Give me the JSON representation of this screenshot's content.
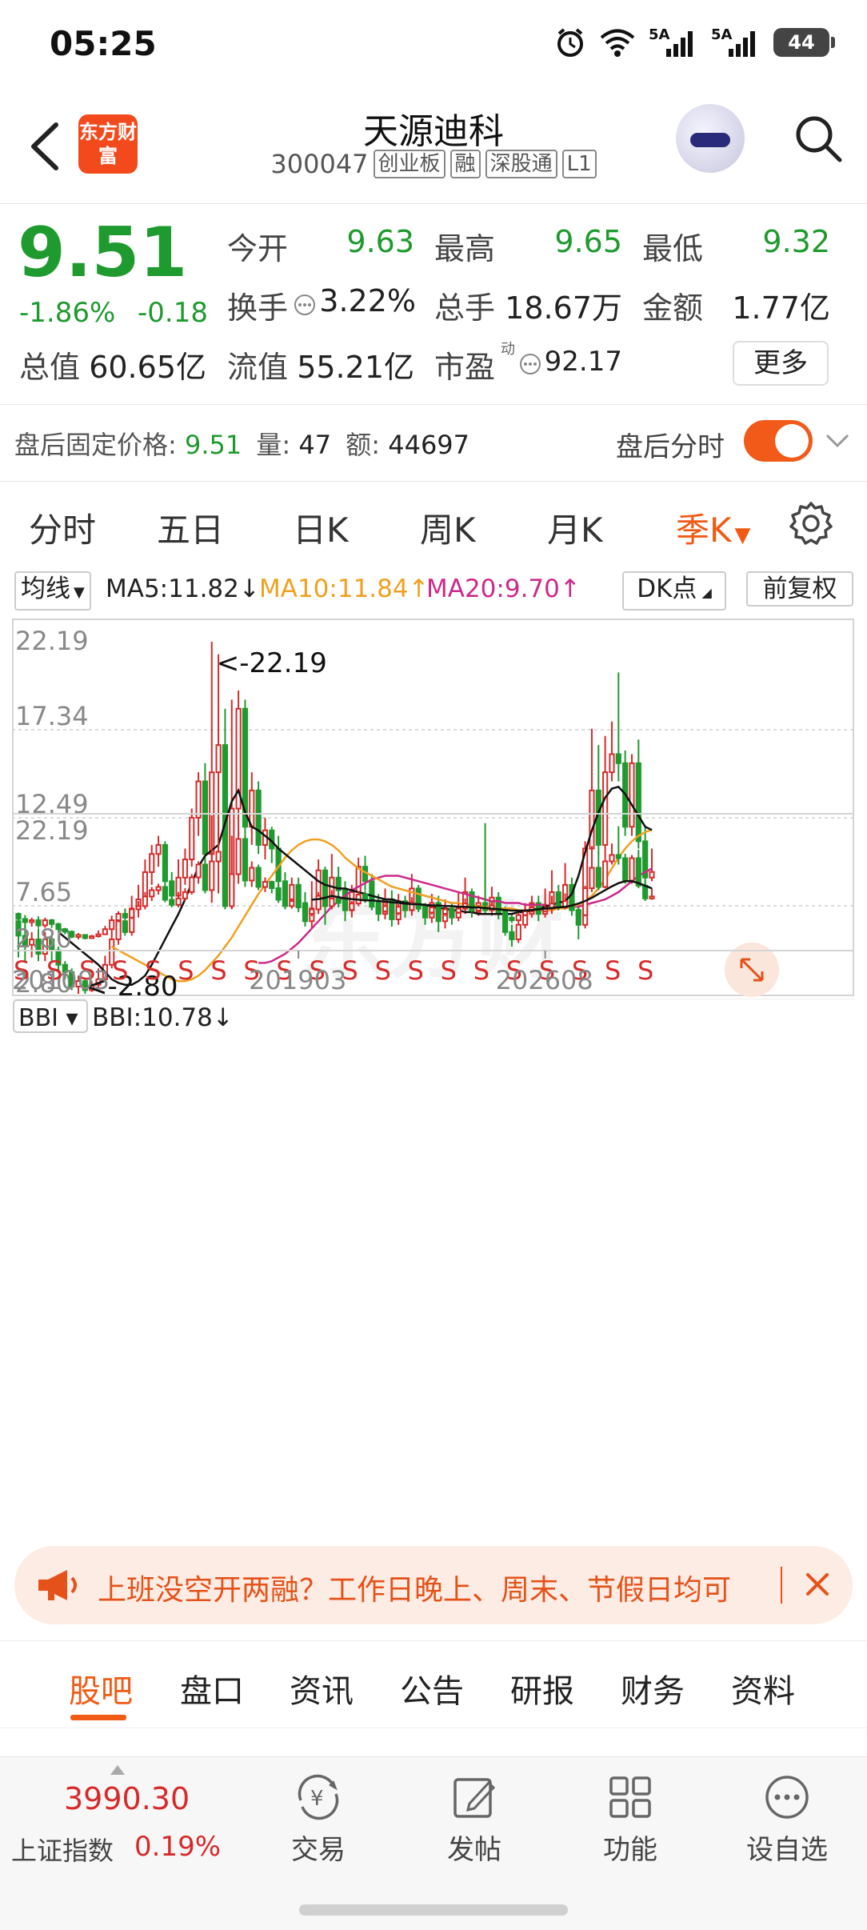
{
  "status": {
    "time": "05:25",
    "sig1": "5A",
    "sig2": "5A",
    "battery": "44"
  },
  "header": {
    "logo": "东方财富",
    "name": "天源迪科",
    "code": "300047",
    "tags": [
      "创业板",
      "融",
      "深股通",
      "L1"
    ]
  },
  "quote": {
    "price": "9.51",
    "change_pct": "-1.86%",
    "change": "-0.18",
    "labels": {
      "open": "今开",
      "high": "最高",
      "low": "最低",
      "turnover": "换手",
      "volume": "总手",
      "amount": "金额",
      "mcap": "总值",
      "float": "流值",
      "pe": "市盈"
    },
    "open": "9.63",
    "high": "9.65",
    "low": "9.32",
    "turnover": "3.22%",
    "volume": "18.67万",
    "amount": "1.77亿",
    "mcap": "60.65亿",
    "float": "55.21亿",
    "pe_sup": "动",
    "pe": "92.17",
    "more": "更多"
  },
  "after_hours": {
    "price_label": "盘后固定价格:",
    "price": "9.51",
    "vol_label": "量:",
    "vol": "47",
    "amt_label": "额:",
    "amt": "44697",
    "toggle_label": "盘后分时",
    "toggle_on": true
  },
  "tabs": [
    "分时",
    "五日",
    "日K",
    "周K",
    "月K",
    "季K"
  ],
  "active_tab": "季K",
  "indicators": {
    "ma_select": "均线",
    "ma5": "MA5:11.82↓",
    "ma10": "MA10:11.84↑",
    "ma20": "MA20:9.70↑",
    "dk": "DK点",
    "adjust": "前复权",
    "bbi_select": "BBI",
    "bbi": "BBI:10.78↓"
  },
  "colors": {
    "up": "#d62a2a",
    "down": "#1f9a2f",
    "ma5": "#111111",
    "ma10": "#f0a020",
    "ma20": "#cc2a8a",
    "accent": "#f05a14"
  },
  "chart_data": {
    "type": "candlestick",
    "title": "",
    "main_y_ticks": [
      "22.19",
      "17.34",
      "12.49",
      "7.65",
      "2.80"
    ],
    "sub_y_ticks": [
      "22.19",
      "2.80"
    ],
    "x_ticks": [
      "201003",
      "201903",
      "202608"
    ],
    "ylim": [
      2.8,
      22.19
    ],
    "max_label": "<-22.19",
    "min_label": "<-2.80",
    "signals": [
      "S",
      "S",
      "S",
      "S",
      "S",
      "S",
      "S",
      "S",
      "S",
      "S",
      "S",
      "S",
      "S",
      "S",
      "S",
      "S",
      "S",
      "S",
      "S",
      "S"
    ],
    "candles": [
      [
        6.8,
        6.0,
        7.0,
        4.8
      ],
      [
        6.0,
        5.5,
        6.6,
        4.5
      ],
      [
        5.5,
        5.8,
        6.2,
        4.8
      ],
      [
        5.8,
        5.0,
        6.4,
        4.6
      ],
      [
        5.0,
        5.8,
        6.2,
        4.6
      ],
      [
        5.8,
        5.2,
        6.0,
        4.6
      ],
      [
        5.2,
        4.4,
        5.4,
        4.0
      ],
      [
        4.4,
        4.0,
        4.6,
        3.6
      ],
      [
        4.0,
        3.2,
        4.2,
        3.0
      ],
      [
        3.2,
        3.5,
        3.8,
        2.8
      ],
      [
        3.5,
        3.0,
        3.6,
        2.8
      ],
      [
        3.0,
        3.3,
        3.5,
        2.9
      ],
      [
        3.3,
        3.6,
        4.2,
        3.1
      ],
      [
        3.6,
        4.4,
        4.9,
        3.5
      ],
      [
        4.4,
        5.8,
        6.5,
        4.2
      ],
      [
        5.8,
        6.8,
        7.2,
        5.5
      ],
      [
        6.8,
        6.2,
        7.5,
        6.0
      ],
      [
        6.2,
        7.5,
        8.2,
        6.0
      ],
      [
        7.5,
        8.0,
        8.8,
        7.0
      ],
      [
        8.0,
        9.5,
        10.2,
        7.5
      ],
      [
        9.5,
        10.5,
        11.0,
        8.8
      ],
      [
        10.5,
        11.0,
        11.5,
        9.8
      ],
      [
        11.0,
        9.0,
        11.2,
        8.6
      ],
      [
        9.0,
        8.2,
        9.5,
        7.8
      ],
      [
        8.2,
        9.2,
        10.2,
        7.8
      ],
      [
        9.2,
        10.2,
        10.8,
        8.8
      ],
      [
        10.2,
        12.5,
        13.0,
        9.8
      ],
      [
        12.5,
        14.5,
        15.0,
        11.5
      ],
      [
        14.5,
        10.5,
        15.5,
        10.0
      ],
      [
        10.5,
        15.0,
        22.19,
        8.5
      ],
      [
        15.0,
        16.5,
        21.5,
        10.0
      ],
      [
        16.5,
        8.0,
        18.5,
        7.5
      ],
      [
        8.0,
        13.0,
        19.0,
        7.5
      ],
      [
        13.0,
        18.5,
        19.5,
        11.5
      ],
      [
        18.5,
        12.0,
        19.0,
        11.0
      ],
      [
        12.0,
        14.0,
        15.0,
        11.0
      ],
      [
        14.0,
        11.0,
        14.5,
        10.5
      ],
      [
        11.0,
        11.8,
        12.5,
        10.2
      ],
      [
        11.8,
        10.8,
        12.0,
        10.0
      ],
      [
        10.8,
        9.0,
        11.5,
        8.5
      ],
      [
        9.0,
        8.0,
        9.5,
        7.5
      ],
      [
        8.0,
        8.8,
        9.2,
        7.6
      ],
      [
        8.8,
        7.8,
        9.2,
        7.3
      ],
      [
        7.8,
        6.8,
        8.4,
        6.5
      ],
      [
        6.8,
        7.5,
        9.0,
        6.4
      ],
      [
        7.5,
        9.6,
        10.2,
        7.2
      ],
      [
        9.6,
        8.0,
        9.8,
        6.6
      ],
      [
        8.0,
        9.2,
        10.5,
        7.5
      ],
      [
        9.2,
        8.5,
        9.8,
        7.8
      ],
      [
        8.5,
        7.4,
        9.0,
        6.8
      ],
      [
        7.4,
        8.4,
        8.8,
        7.0
      ],
      [
        8.4,
        9.8,
        10.3,
        8.0
      ],
      [
        9.8,
        9.0,
        10.4,
        8.5
      ],
      [
        9.0,
        7.9,
        9.4,
        7.4
      ],
      [
        7.9,
        7.2,
        8.3,
        6.8
      ],
      [
        7.2,
        8.0,
        8.6,
        6.9
      ],
      [
        8.0,
        6.9,
        8.5,
        6.5
      ],
      [
        6.9,
        7.9,
        8.3,
        6.6
      ],
      [
        7.9,
        7.4,
        8.2,
        7.0
      ],
      [
        7.4,
        8.6,
        9.4,
        7.1
      ],
      [
        8.6,
        7.6,
        8.8,
        7.3
      ],
      [
        7.6,
        7.0,
        7.8,
        6.6
      ],
      [
        7.0,
        7.8,
        8.3,
        6.7
      ],
      [
        7.8,
        6.8,
        8.2,
        6.2
      ],
      [
        6.8,
        7.5,
        8.0,
        6.4
      ],
      [
        7.5,
        7.0,
        7.8,
        6.6
      ],
      [
        7.0,
        7.6,
        8.4,
        6.8
      ],
      [
        7.6,
        8.4,
        9.2,
        7.2
      ],
      [
        8.4,
        7.3,
        8.6,
        7.0
      ],
      [
        7.3,
        7.8,
        8.2,
        7.1
      ],
      [
        7.8,
        7.4,
        12.2,
        7.2
      ],
      [
        7.4,
        8.1,
        8.7,
        7.1
      ],
      [
        8.1,
        7.2,
        8.4,
        6.9
      ],
      [
        7.2,
        6.2,
        7.6,
        6.0
      ],
      [
        6.2,
        5.8,
        6.6,
        5.4
      ],
      [
        5.8,
        6.6,
        7.0,
        5.6
      ],
      [
        6.6,
        7.2,
        7.8,
        6.4
      ],
      [
        7.2,
        7.8,
        8.2,
        7.0
      ],
      [
        7.8,
        7.2,
        8.2,
        6.8
      ],
      [
        7.2,
        7.6,
        8.6,
        7.0
      ],
      [
        7.6,
        8.4,
        9.6,
        7.2
      ],
      [
        8.4,
        7.8,
        8.8,
        7.4
      ],
      [
        7.8,
        8.8,
        10.0,
        7.5
      ],
      [
        8.8,
        7.4,
        9.2,
        7.1
      ],
      [
        7.4,
        6.6,
        7.8,
        5.8
      ],
      [
        6.6,
        10.8,
        11.2,
        6.4
      ],
      [
        10.8,
        14.0,
        17.4,
        10.2
      ],
      [
        14.0,
        11.0,
        16.5,
        10.5
      ],
      [
        11.0,
        15.0,
        17.0,
        10.8
      ],
      [
        15.0,
        16.0,
        17.8,
        14.5
      ],
      [
        16.0,
        15.5,
        20.5,
        14.5
      ],
      [
        15.5,
        12.0,
        16.2,
        11.5
      ],
      [
        12.0,
        15.5,
        16.0,
        11.5
      ],
      [
        15.5,
        11.2,
        16.8,
        10.8
      ],
      [
        11.2,
        9.2,
        12.0,
        8.8
      ],
      [
        9.2,
        9.51,
        10.8,
        9.0
      ]
    ],
    "ma5": [
      6.2,
      5.9,
      5.6,
      5.3,
      5.0,
      4.7,
      4.4,
      4.0,
      3.6,
      3.4,
      3.3,
      3.3,
      3.5,
      3.8,
      4.4,
      5.1,
      5.8,
      6.5,
      7.2,
      8.0,
      8.9,
      9.8,
      10.4,
      10.7,
      11.0,
      12.2,
      13.4,
      14.0,
      12.8,
      12.0,
      11.8,
      11.5,
      11.2,
      10.8,
      10.5,
      10.2,
      9.9,
      9.6,
      9.3,
      9.0,
      8.8,
      8.7,
      8.6,
      8.6,
      8.5,
      8.4,
      8.3,
      8.2,
      8.1,
      8.0,
      8.0,
      7.9,
      7.8,
      7.8,
      7.7,
      7.7,
      7.6,
      7.5,
      7.5,
      7.4,
      7.4,
      7.3,
      7.3,
      7.2,
      7.2,
      7.2,
      7.2,
      7.2,
      7.2,
      7.3,
      7.3,
      7.4,
      7.5,
      7.6,
      7.7,
      7.8,
      7.9,
      8.3,
      9.3,
      10.6,
      11.8,
      12.8,
      13.6,
      14.1,
      14.2,
      13.8,
      13.2,
      12.6,
      12.0,
      11.82
    ],
    "ma10": [
      5.4,
      5.2,
      5.0,
      4.8,
      4.6,
      4.4,
      4.2,
      4.0,
      3.8,
      3.6,
      3.5,
      3.5,
      3.6,
      3.8,
      4.1,
      4.5,
      4.9,
      5.4,
      5.9,
      6.5,
      7.1,
      7.7,
      8.3,
      8.8,
      9.3,
      9.8,
      10.3,
      10.7,
      11.0,
      11.2,
      11.3,
      11.3,
      11.2,
      11.0,
      10.7,
      10.3,
      10.0,
      9.7,
      9.5,
      9.3,
      9.1,
      8.9,
      8.7,
      8.6,
      8.5,
      8.4,
      8.3,
      8.2,
      8.1,
      8.0,
      7.9,
      7.8,
      7.8,
      7.7,
      7.7,
      7.6,
      7.6,
      7.6,
      7.5,
      7.5,
      7.5,
      7.4,
      7.4,
      7.4,
      7.4,
      7.4,
      7.4,
      7.5,
      7.5,
      7.6,
      7.7,
      7.9,
      8.2,
      8.6,
      9.1,
      9.7,
      10.3,
      10.8,
      11.2,
      11.5,
      11.7,
      11.84
    ],
    "ma20": [
      4.5,
      4.5,
      4.6,
      4.8,
      5.0,
      5.3,
      5.6,
      6.0,
      6.4,
      6.8,
      7.2,
      7.6,
      7.9,
      8.2,
      8.5,
      8.7,
      8.9,
      9.1,
      9.2,
      9.3,
      9.3,
      9.3,
      9.2,
      9.1,
      9.0,
      8.9,
      8.8,
      8.7,
      8.6,
      8.5,
      8.4,
      8.3,
      8.2,
      8.1,
      8.0,
      7.9,
      7.9,
      7.8,
      7.8,
      7.8,
      7.7,
      7.7,
      7.7,
      7.7,
      7.6,
      7.6,
      7.6,
      7.6,
      7.6,
      7.7,
      7.8,
      7.9,
      8.0,
      8.2,
      8.4,
      8.7,
      9.0,
      9.3,
      9.5,
      9.7
    ],
    "bbi": [
      9.0,
      9.1,
      9.3,
      9.6,
      9.4,
      9.2,
      9.1,
      9.0,
      8.9,
      8.9,
      8.8,
      8.7,
      8.6,
      8.5,
      8.4,
      8.3,
      8.3,
      8.2,
      8.1,
      8.1,
      8.0,
      8.0,
      7.9,
      7.9,
      7.8,
      7.8,
      7.7,
      7.6,
      7.5,
      7.4,
      7.3,
      7.3,
      7.3,
      7.4,
      7.5,
      7.6,
      7.7,
      7.8,
      7.9,
      8.1,
      8.4,
      8.8,
      9.3,
      9.9,
      10.5,
      11.1,
      11.6,
      11.9,
      11.9,
      11.6,
      11.2,
      10.78
    ]
  },
  "notice": {
    "text": "上班没空开两融？工作日晚上、周末、节假日均可"
  },
  "bottom_tabs": [
    "股吧",
    "盘口",
    "资讯",
    "公告",
    "研报",
    "财务",
    "资料"
  ],
  "active_bottom_tab": "股吧",
  "footer": {
    "index_value": "3990.30",
    "index_name": "上证指数",
    "index_pct": "0.19%",
    "items": [
      "交易",
      "发帖",
      "功能",
      "设自选"
    ]
  }
}
